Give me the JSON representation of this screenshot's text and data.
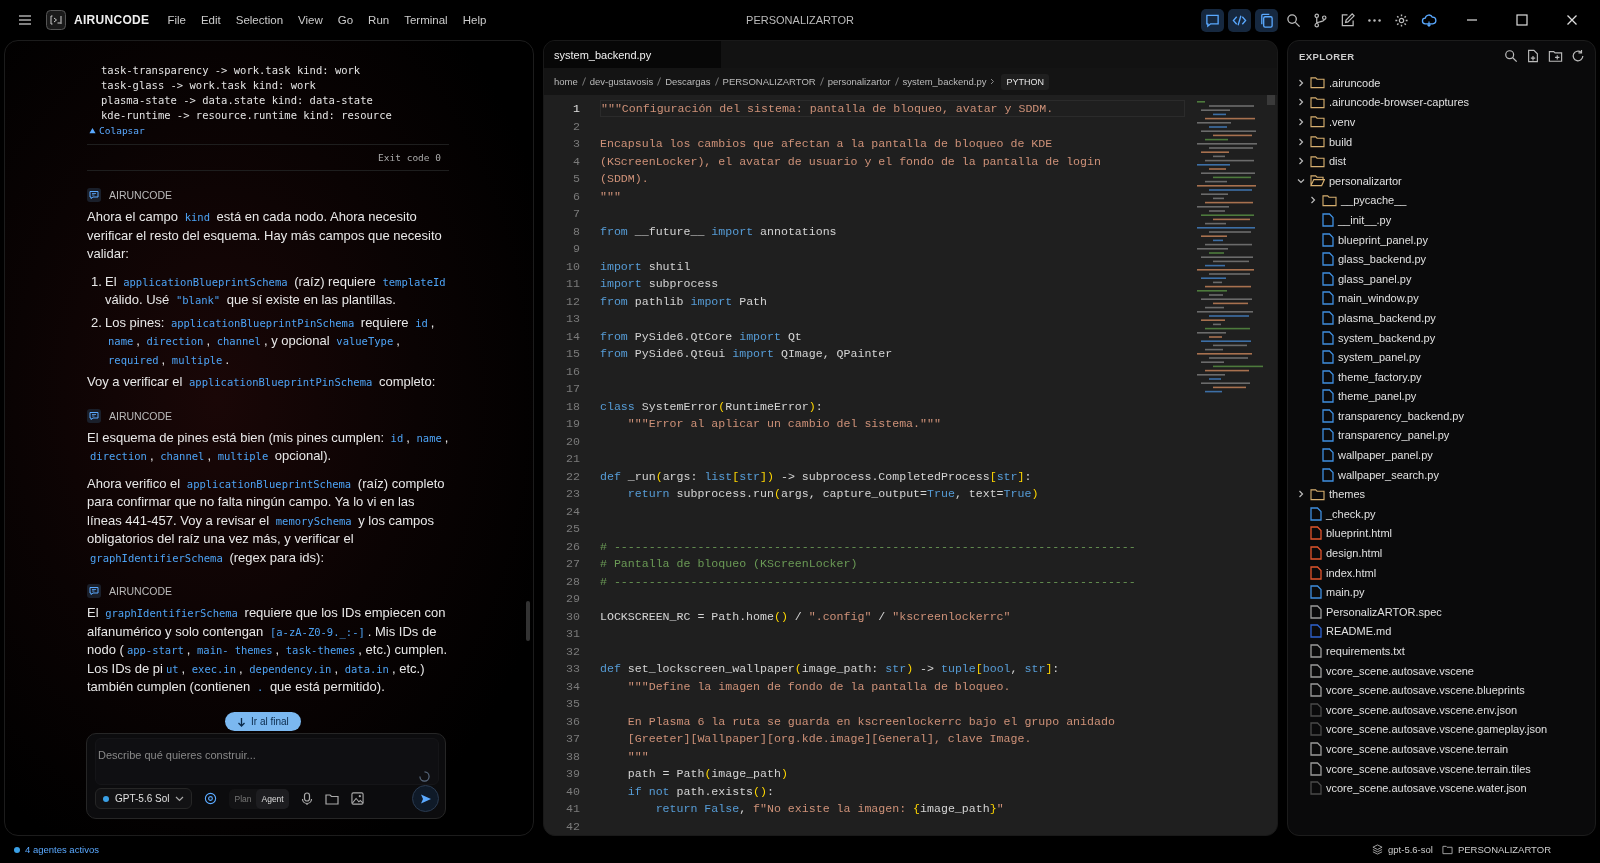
{
  "titlebar": {
    "app_name": "AIRUNCODE",
    "menu": [
      "File",
      "Edit",
      "Selection",
      "View",
      "Go",
      "Run",
      "Terminal",
      "Help"
    ],
    "title": "PERSONALIZARTOR",
    "tools": [
      {
        "kind": "chat",
        "selected": true
      },
      {
        "kind": "code",
        "selected": true
      },
      {
        "kind": "copy",
        "selected": true
      },
      {
        "kind": "search",
        "selected": false
      },
      {
        "kind": "branch",
        "selected": false
      },
      {
        "kind": "edit",
        "selected": false
      },
      {
        "kind": "more",
        "selected": false
      },
      {
        "kind": "settings",
        "selected": false
      },
      {
        "kind": "cloud",
        "selected": false
      }
    ]
  },
  "chat": {
    "output_lines": [
      "task-transparency -> work.task kind: work",
      "task-glass -> work.task kind: work",
      "plasma-state -> data.state kind: data-state",
      "kde-runtime -> resource.runtime kind: resource"
    ],
    "collapse_label": "Colapsar",
    "exit_code": "Exit code 0",
    "messages": [
      {
        "author": "AIRUNCODE",
        "blocks": [
          {
            "kind": "paragraph",
            "parts": [
              {
                "kind": "text",
                "text": "Ahora el campo "
              },
              {
                "kind": "code",
                "text": "kind"
              },
              {
                "kind": "text",
                "text": " está en cada nodo. Ahora necesito verificar el resto del esquema. Hay más campos que necesito validar:"
              }
            ]
          },
          {
            "kind": "list_item",
            "marker": "1.",
            "parts": [
              {
                "kind": "text",
                "text": "El "
              },
              {
                "kind": "code",
                "text": "applicationBlueprintSchema"
              },
              {
                "kind": "text",
                "text": " (raíz) requiere "
              },
              {
                "kind": "code",
                "text": "templateId"
              },
              {
                "kind": "text",
                "text": " válido. Usé "
              },
              {
                "kind": "code",
                "text": "\"blank\""
              },
              {
                "kind": "text",
                "text": " que sí existe en las plantillas."
              }
            ]
          },
          {
            "kind": "list_item",
            "marker": "2.",
            "parts": [
              {
                "kind": "text",
                "text": "Los pines: "
              },
              {
                "kind": "code",
                "text": "applicationBlueprintPinSchema"
              },
              {
                "kind": "text",
                "text": " requiere "
              },
              {
                "kind": "code",
                "text": "id"
              },
              {
                "kind": "text",
                "text": ", "
              },
              {
                "kind": "code",
                "text": "name"
              },
              {
                "kind": "text",
                "text": ", "
              },
              {
                "kind": "code",
                "text": "direction"
              },
              {
                "kind": "text",
                "text": ", "
              },
              {
                "kind": "code",
                "text": "channel"
              },
              {
                "kind": "text",
                "text": ", y opcional "
              },
              {
                "kind": "code",
                "text": "valueType"
              },
              {
                "kind": "text",
                "text": ", "
              },
              {
                "kind": "code",
                "text": "required"
              },
              {
                "kind": "text",
                "text": ", "
              },
              {
                "kind": "code",
                "text": "multiple"
              },
              {
                "kind": "text",
                "text": "."
              }
            ]
          },
          {
            "kind": "paragraph",
            "parts": [
              {
                "kind": "text",
                "text": "Voy a verificar el "
              },
              {
                "kind": "code",
                "text": "applicationBlueprintPinSchema"
              },
              {
                "kind": "text",
                "text": " completo:"
              }
            ]
          }
        ]
      },
      {
        "author": "AIRUNCODE",
        "blocks": [
          {
            "kind": "paragraph",
            "parts": [
              {
                "kind": "text",
                "text": "El esquema de pines está bien (mis pines cumplen: "
              },
              {
                "kind": "code",
                "text": "id"
              },
              {
                "kind": "text",
                "text": ", "
              },
              {
                "kind": "code",
                "text": "name"
              },
              {
                "kind": "text",
                "text": ", "
              },
              {
                "kind": "code",
                "text": "direction"
              },
              {
                "kind": "text",
                "text": ", "
              },
              {
                "kind": "code",
                "text": "channel"
              },
              {
                "kind": "text",
                "text": ", "
              },
              {
                "kind": "code",
                "text": "multiple"
              },
              {
                "kind": "text",
                "text": " opcional)."
              }
            ]
          },
          {
            "kind": "paragraph",
            "parts": [
              {
                "kind": "text",
                "text": "Ahora verifico el "
              },
              {
                "kind": "code",
                "text": "applicationBlueprintSchema"
              },
              {
                "kind": "text",
                "text": " (raíz) completo para confirmar que no falta ningún campo. Ya lo vi en las líneas 441-457. Voy a revisar el "
              },
              {
                "kind": "code",
                "text": "memorySchema"
              },
              {
                "kind": "text",
                "text": " y los campos obligatorios del raíz una vez más, y verificar el "
              },
              {
                "kind": "code",
                "text": "graphIdentifierSchema"
              },
              {
                "kind": "text",
                "text": " (regex para ids):"
              }
            ]
          }
        ]
      },
      {
        "author": "AIRUNCODE",
        "blocks": [
          {
            "kind": "paragraph",
            "parts": [
              {
                "kind": "text",
                "text": "El "
              },
              {
                "kind": "code",
                "text": "graphIdentifierSchema"
              },
              {
                "kind": "text",
                "text": " requiere que los IDs empiecen con alfanumérico y solo contengan "
              },
              {
                "kind": "code",
                "text": "[a-zA-Z0-9._:-]"
              },
              {
                "kind": "text",
                "text": ". Mis IDs de nodo ("
              },
              {
                "kind": "code",
                "text": "app-start"
              },
              {
                "kind": "text",
                "text": ", "
              },
              {
                "kind": "code",
                "text": "main-"
              },
              {
                "kind": "code",
                "text": "themes"
              },
              {
                "kind": "text",
                "text": ", "
              },
              {
                "kind": "code",
                "text": "task-themes"
              },
              {
                "kind": "text",
                "text": ", etc.) cumplen. Los IDs de pi"
              },
              {
                "kind": "code",
                "text": "ut"
              },
              {
                "kind": "text",
                "text": ", "
              },
              {
                "kind": "code",
                "text": "exec.in"
              },
              {
                "kind": "text",
                "text": ", "
              },
              {
                "kind": "code",
                "text": "dependency.in"
              },
              {
                "kind": "text",
                "text": ", "
              },
              {
                "kind": "code",
                "text": "data.in"
              },
              {
                "kind": "text",
                "text": ", etc.) también cumplen (contienen "
              },
              {
                "kind": "code",
                "text": "."
              },
              {
                "kind": "text",
                "text": " que está permitido)."
              }
            ]
          }
        ]
      }
    ],
    "jump_button": "Ir al final",
    "composer": {
      "placeholder": "Describe qué quieres construir...",
      "model": "GPT-5.6 Sol",
      "modes": [
        {
          "label": "Plan",
          "selected": false
        },
        {
          "label": "Agent",
          "selected": true
        }
      ]
    }
  },
  "editor": {
    "tabs": [
      {
        "label": "system_backend.py",
        "selected": true
      }
    ],
    "breadcrumbs": [
      "home",
      "dev-gustavosis",
      "Descargas",
      "PERSONALIZARTOR",
      "personalizartor",
      "system_backend.py"
    ],
    "language": "PYTHON",
    "lines": [
      {
        "number": "1",
        "current": true,
        "tokens": [
          {
            "kind": "string",
            "text": "\"\"\"Configuración del sistema: pantalla de bloqueo, avatar y SDDM."
          }
        ]
      },
      {
        "number": "2",
        "current": false
      },
      {
        "number": "3",
        "current": false,
        "tokens": [
          {
            "kind": "string",
            "text": "Encapsula los cambios que afectan a la pantalla de bloqueo de KDE"
          }
        ]
      },
      {
        "number": "4",
        "current": false,
        "tokens": [
          {
            "kind": "string",
            "text": "(KScreenLocker), el avatar de usuario y el fondo de la pantalla de login"
          }
        ]
      },
      {
        "number": "5",
        "current": false,
        "tokens": [
          {
            "kind": "string",
            "text": "(SDDM)."
          }
        ]
      },
      {
        "number": "6",
        "current": false,
        "tokens": [
          {
            "kind": "string",
            "text": "\"\"\""
          }
        ]
      },
      {
        "number": "7",
        "current": false
      },
      {
        "number": "8",
        "current": false,
        "tokens": [
          {
            "kind": "keyword",
            "text": "from"
          },
          {
            "kind": "plain",
            "text": " __future__ "
          },
          {
            "kind": "keyword",
            "text": "import"
          },
          {
            "kind": "plain",
            "text": " annotations"
          }
        ]
      },
      {
        "number": "9",
        "current": false
      },
      {
        "number": "10",
        "current": false,
        "tokens": [
          {
            "kind": "keyword",
            "text": "import"
          },
          {
            "kind": "plain",
            "text": " shutil"
          }
        ]
      },
      {
        "number": "11",
        "current": false,
        "tokens": [
          {
            "kind": "keyword",
            "text": "import"
          },
          {
            "kind": "plain",
            "text": " subprocess"
          }
        ]
      },
      {
        "number": "12",
        "current": false,
        "tokens": [
          {
            "kind": "keyword",
            "text": "from"
          },
          {
            "kind": "plain",
            "text": " pathlib "
          },
          {
            "kind": "keyword",
            "text": "import"
          },
          {
            "kind": "plain",
            "text": " Path"
          }
        ]
      },
      {
        "number": "13",
        "current": false
      },
      {
        "number": "14",
        "current": false,
        "tokens": [
          {
            "kind": "keyword",
            "text": "from"
          },
          {
            "kind": "plain",
            "text": " PySide6.QtCore "
          },
          {
            "kind": "keyword",
            "text": "import"
          },
          {
            "kind": "plain",
            "text": " Qt"
          }
        ]
      },
      {
        "number": "15",
        "current": false,
        "tokens": [
          {
            "kind": "keyword",
            "text": "from"
          },
          {
            "kind": "plain",
            "text": " PySide6.QtGui "
          },
          {
            "kind": "keyword",
            "text": "import"
          },
          {
            "kind": "plain",
            "text": " QImage, QPainter"
          }
        ]
      },
      {
        "number": "16",
        "current": false
      },
      {
        "number": "17",
        "current": false
      },
      {
        "number": "18",
        "current": false,
        "tokens": [
          {
            "kind": "keyword",
            "text": "class"
          },
          {
            "kind": "plain",
            "text": " SystemError"
          },
          {
            "kind": "bracket",
            "text": "("
          },
          {
            "kind": "plain",
            "text": "RuntimeError"
          },
          {
            "kind": "bracket",
            "text": ")"
          },
          {
            "kind": "plain",
            "text": ":"
          }
        ]
      },
      {
        "number": "19",
        "current": false,
        "tokens": [
          {
            "kind": "string",
            "text": "    \"\"\"Error al aplicar un cambio del sistema.\"\"\""
          }
        ]
      },
      {
        "number": "20",
        "current": false
      },
      {
        "number": "21",
        "current": false
      },
      {
        "number": "22",
        "current": false,
        "tokens": [
          {
            "kind": "keyword",
            "text": "def"
          },
          {
            "kind": "plain",
            "text": " _run"
          },
          {
            "kind": "bracket",
            "text": "("
          },
          {
            "kind": "plain",
            "text": "args: "
          },
          {
            "kind": "keyword",
            "text": "list"
          },
          {
            "kind": "bracket",
            "text": "["
          },
          {
            "kind": "keyword",
            "text": "str"
          },
          {
            "kind": "bracket",
            "text": "])"
          },
          {
            "kind": "plain",
            "text": " -> subprocess.CompletedProcess"
          },
          {
            "kind": "bracket",
            "text": "["
          },
          {
            "kind": "keyword",
            "text": "str"
          },
          {
            "kind": "bracket",
            "text": "]"
          },
          {
            "kind": "plain",
            "text": ":"
          }
        ]
      },
      {
        "number": "23",
        "current": false,
        "tokens": [
          {
            "kind": "keyword",
            "text": "    return"
          },
          {
            "kind": "plain",
            "text": " subprocess.run"
          },
          {
            "kind": "bracket",
            "text": "("
          },
          {
            "kind": "plain",
            "text": "args, capture_output="
          },
          {
            "kind": "keyword",
            "text": "True"
          },
          {
            "kind": "plain",
            "text": ", text="
          },
          {
            "kind": "keyword",
            "text": "True"
          },
          {
            "kind": "bracket",
            "text": ")"
          }
        ]
      },
      {
        "number": "24",
        "current": false
      },
      {
        "number": "25",
        "current": false
      },
      {
        "number": "26",
        "current": false,
        "tokens": [
          {
            "kind": "comment",
            "text": "# ---------------------------------------------------------------------------"
          }
        ]
      },
      {
        "number": "27",
        "current": false,
        "tokens": [
          {
            "kind": "comment",
            "text": "# Pantalla de bloqueo (KScreenLocker)"
          }
        ]
      },
      {
        "number": "28",
        "current": false,
        "tokens": [
          {
            "kind": "comment",
            "text": "# ---------------------------------------------------------------------------"
          }
        ]
      },
      {
        "number": "29",
        "current": false
      },
      {
        "number": "30",
        "current": false,
        "tokens": [
          {
            "kind": "plain",
            "text": "LOCKSCREEN_RC = Path.home"
          },
          {
            "kind": "bracket",
            "text": "()"
          },
          {
            "kind": "plain",
            "text": " / "
          },
          {
            "kind": "string",
            "text": "\".config\""
          },
          {
            "kind": "plain",
            "text": " / "
          },
          {
            "kind": "string",
            "text": "\"kscreenlockerrc\""
          }
        ]
      },
      {
        "number": "31",
        "current": false
      },
      {
        "number": "32",
        "current": false
      },
      {
        "number": "33",
        "current": false,
        "tokens": [
          {
            "kind": "keyword",
            "text": "def"
          },
          {
            "kind": "plain",
            "text": " set_lockscreen_wallpaper"
          },
          {
            "kind": "bracket",
            "text": "("
          },
          {
            "kind": "plain",
            "text": "image_path: "
          },
          {
            "kind": "keyword",
            "text": "str"
          },
          {
            "kind": "bracket",
            "text": ")"
          },
          {
            "kind": "plain",
            "text": " -> "
          },
          {
            "kind": "keyword",
            "text": "tuple"
          },
          {
            "kind": "bracket",
            "text": "["
          },
          {
            "kind": "keyword",
            "text": "bool"
          },
          {
            "kind": "plain",
            "text": ", "
          },
          {
            "kind": "keyword",
            "text": "str"
          },
          {
            "kind": "bracket",
            "text": "]"
          },
          {
            "kind": "plain",
            "text": ":"
          }
        ]
      },
      {
        "number": "34",
        "current": false,
        "tokens": [
          {
            "kind": "string",
            "text": "    \"\"\"Define la imagen de fondo de la pantalla de bloqueo."
          }
        ]
      },
      {
        "number": "35",
        "current": false
      },
      {
        "number": "36",
        "current": false,
        "tokens": [
          {
            "kind": "string",
            "text": "    En Plasma 6 la ruta se guarda en kscreenlockerrc bajo el grupo anidado"
          }
        ]
      },
      {
        "number": "37",
        "current": false,
        "tokens": [
          {
            "kind": "string",
            "text": "    [Greeter][Wallpaper][org.kde.image][General], clave Image."
          }
        ]
      },
      {
        "number": "38",
        "current": false,
        "tokens": [
          {
            "kind": "string",
            "text": "    \"\"\""
          }
        ]
      },
      {
        "number": "39",
        "current": false,
        "tokens": [
          {
            "kind": "plain",
            "text": "    path = Path"
          },
          {
            "kind": "bracket",
            "text": "("
          },
          {
            "kind": "plain",
            "text": "image_path"
          },
          {
            "kind": "bracket",
            "text": ")"
          }
        ]
      },
      {
        "number": "40",
        "current": false,
        "tokens": [
          {
            "kind": "keyword",
            "text": "    if"
          },
          {
            "kind": "keyword",
            "text": " not"
          },
          {
            "kind": "plain",
            "text": " path.exists"
          },
          {
            "kind": "bracket",
            "text": "()"
          },
          {
            "kind": "plain",
            "text": ":"
          }
        ]
      },
      {
        "number": "41",
        "current": false,
        "tokens": [
          {
            "kind": "keyword",
            "text": "        return"
          },
          {
            "kind": "keyword",
            "text": " False"
          },
          {
            "kind": "plain",
            "text": ", "
          },
          {
            "kind": "string",
            "text": "f\"No existe la imagen: "
          },
          {
            "kind": "bracket",
            "text": "{"
          },
          {
            "kind": "plain",
            "text": "image_path"
          },
          {
            "kind": "bracket",
            "text": "}"
          },
          {
            "kind": "string",
            "text": "\""
          }
        ]
      },
      {
        "number": "42",
        "current": false
      }
    ]
  },
  "explorer": {
    "title": "EXPLORER",
    "tree": [
      {
        "name": ".airuncode",
        "kind": "folder",
        "expanded": false
      },
      {
        "name": ".airuncode-browser-captures",
        "kind": "folder",
        "expanded": false
      },
      {
        "name": ".venv",
        "kind": "folder",
        "expanded": false
      },
      {
        "name": "build",
        "kind": "folder",
        "expanded": false
      },
      {
        "name": "dist",
        "kind": "folder",
        "expanded": false
      },
      {
        "name": "personalizartor",
        "kind": "folder",
        "expanded": true,
        "children": [
          {
            "name": "__pycache__",
            "kind": "folder",
            "expanded": false
          },
          {
            "name": "__init__.py",
            "kind": "python"
          },
          {
            "name": "blueprint_panel.py",
            "kind": "python"
          },
          {
            "name": "glass_backend.py",
            "kind": "python"
          },
          {
            "name": "glass_panel.py",
            "kind": "python"
          },
          {
            "name": "main_window.py",
            "kind": "python"
          },
          {
            "name": "plasma_backend.py",
            "kind": "python"
          },
          {
            "name": "system_backend.py",
            "kind": "python"
          },
          {
            "name": "system_panel.py",
            "kind": "python"
          },
          {
            "name": "theme_factory.py",
            "kind": "python"
          },
          {
            "name": "theme_panel.py",
            "kind": "python"
          },
          {
            "name": "transparency_backend.py",
            "kind": "python"
          },
          {
            "name": "transparency_panel.py",
            "kind": "python"
          },
          {
            "name": "wallpaper_panel.py",
            "kind": "python"
          },
          {
            "name": "wallpaper_search.py",
            "kind": "python"
          }
        ]
      },
      {
        "name": "themes",
        "kind": "folder",
        "expanded": false
      },
      {
        "name": "_check.py",
        "kind": "python"
      },
      {
        "name": "blueprint.html",
        "kind": "html"
      },
      {
        "name": "design.html",
        "kind": "html"
      },
      {
        "name": "index.html",
        "kind": "html"
      },
      {
        "name": "main.py",
        "kind": "python"
      },
      {
        "name": "PersonalizARTOR.spec",
        "kind": "file"
      },
      {
        "name": "README.md",
        "kind": "markdown"
      },
      {
        "name": "requirements.txt",
        "kind": "file"
      },
      {
        "name": "vcore_scene.autosave.vscene",
        "kind": "file"
      },
      {
        "name": "vcore_scene.autosave.vscene.blueprints",
        "kind": "file"
      },
      {
        "name": "vcore_scene.autosave.vscene.env.json",
        "kind": "data"
      },
      {
        "name": "vcore_scene.autosave.vscene.gameplay.json",
        "kind": "data"
      },
      {
        "name": "vcore_scene.autosave.vscene.terrain",
        "kind": "file"
      },
      {
        "name": "vcore_scene.autosave.vscene.terrain.tiles",
        "kind": "file"
      },
      {
        "name": "vcore_scene.autosave.vscene.water.json",
        "kind": "data"
      }
    ]
  },
  "status_bar": {
    "agents": "4 agentes activos",
    "model": "gpt-5.6-sol",
    "project": "PERSONALIZARTOR"
  }
}
